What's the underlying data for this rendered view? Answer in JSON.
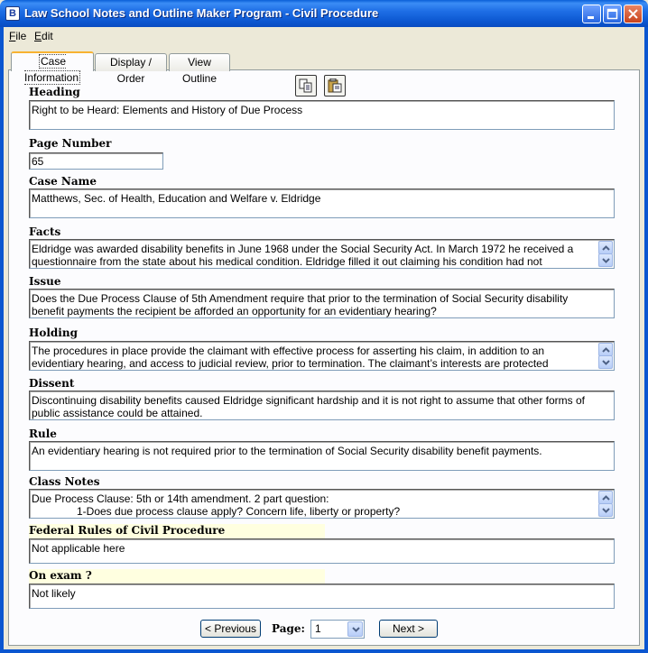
{
  "window": {
    "title": "Law School Notes and Outline Maker Program - Civil Procedure",
    "icon_letter": "B"
  },
  "menu": {
    "file": "File",
    "edit": "Edit"
  },
  "tabs": [
    {
      "label": "Case Information"
    },
    {
      "label": "Display / Order"
    },
    {
      "label": "View Outline"
    }
  ],
  "fields": {
    "heading": {
      "label": "Heading",
      "value": "Right to be Heard: Elements and History of Due Process"
    },
    "page_number": {
      "label": "Page Number",
      "value": "65"
    },
    "case_name": {
      "label": "Case Name",
      "value": "Matthews, Sec. of Health, Education and Welfare v. Eldridge"
    },
    "facts": {
      "label": "Facts",
      "lines": [
        "Eldridge was awarded disability benefits in June 1968 under the Social Security Act.  In March 1972 he received a",
        "questionnaire from the state about his medical condition.  Eldridge filled it out claiming his condition had not"
      ]
    },
    "issue": {
      "label": "Issue",
      "lines": [
        "Does the Due Process Clause of 5th Amendment require that prior to the termination of Social Security disability",
        "benefit payments the recipient be afforded an opportunity for an evidentiary hearing?"
      ]
    },
    "holding": {
      "label": "Holding",
      "lines": [
        "The procedures in place provide the claimant with effective process for asserting his claim, in addition to an",
        "evidentiary hearing, and access to judicial review, prior to termination.  The claimant’s interests are protected"
      ]
    },
    "dissent": {
      "label": "Dissent",
      "lines": [
        "Discontinuing disability benefits caused Eldridge significant hardship and it is not right to assume that other forms of",
        "public assistance could be attained."
      ]
    },
    "rule": {
      "label": "Rule",
      "value": "An evidentiary hearing is not required prior to the termination of Social Security disability benefit payments."
    },
    "class_notes": {
      "label": "Class Notes",
      "lines": [
        "Due Process Clause: 5th or 14th amendment. 2 part question:",
        "1-Does due process clause apply? Concern life, liberty or property?"
      ]
    },
    "frcp": {
      "label": "Federal Rules of Civil Procedure",
      "value": "Not applicable here"
    },
    "on_exam": {
      "label": "On exam ?",
      "value": "Not likely"
    }
  },
  "pager": {
    "previous": "< Previous",
    "page_label": "Page:",
    "page_value": "1",
    "next": "Next >"
  }
}
